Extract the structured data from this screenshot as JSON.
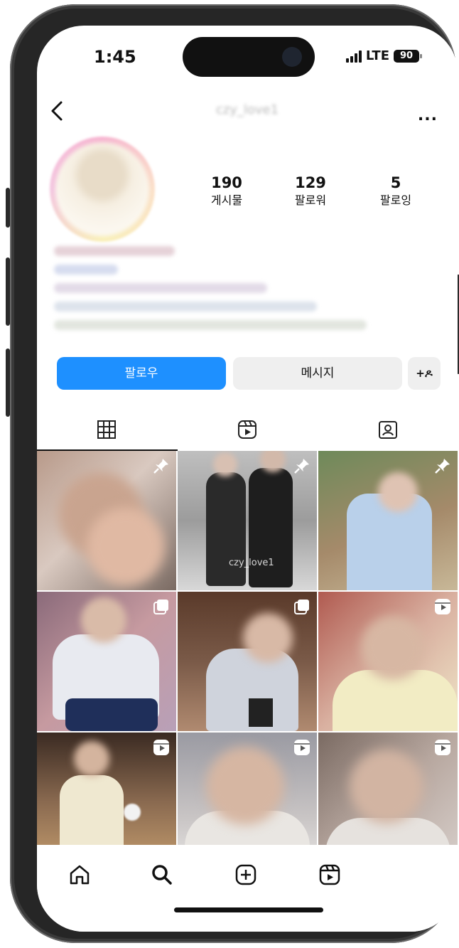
{
  "status_bar": {
    "time": "1:45",
    "network": "LTE",
    "battery": "90"
  },
  "header": {
    "username": "czy_love1",
    "back_icon": "chevron-left-icon",
    "more_label": "..."
  },
  "profile": {
    "stats": [
      {
        "value": "190",
        "label": "게시물"
      },
      {
        "value": "129",
        "label": "팔로워"
      },
      {
        "value": "5",
        "label": "팔로잉"
      }
    ]
  },
  "actions": {
    "follow_label": "팔로우",
    "message_label": "메시지",
    "add_person_label": "+ዶ"
  },
  "tabs": [
    {
      "icon": "grid-icon"
    },
    {
      "icon": "reels-icon"
    },
    {
      "icon": "tagged-icon"
    }
  ],
  "grid": {
    "watermark": "czy_love1",
    "posts": [
      {
        "overlay": "pin-icon"
      },
      {
        "overlay": "pin-icon"
      },
      {
        "overlay": "pin-icon"
      },
      {
        "overlay": "carousel-icon"
      },
      {
        "overlay": "carousel-icon"
      },
      {
        "overlay": "reels-icon"
      },
      {
        "overlay": "reels-icon"
      },
      {
        "overlay": "reels-icon"
      },
      {
        "overlay": "reels-icon"
      }
    ]
  },
  "bottom_nav": [
    {
      "icon": "home-icon"
    },
    {
      "icon": "search-icon"
    },
    {
      "icon": "add-post-icon"
    },
    {
      "icon": "reels-icon"
    }
  ],
  "colors": {
    "accent": "#1e90ff",
    "secondary_button": "#efefef"
  }
}
